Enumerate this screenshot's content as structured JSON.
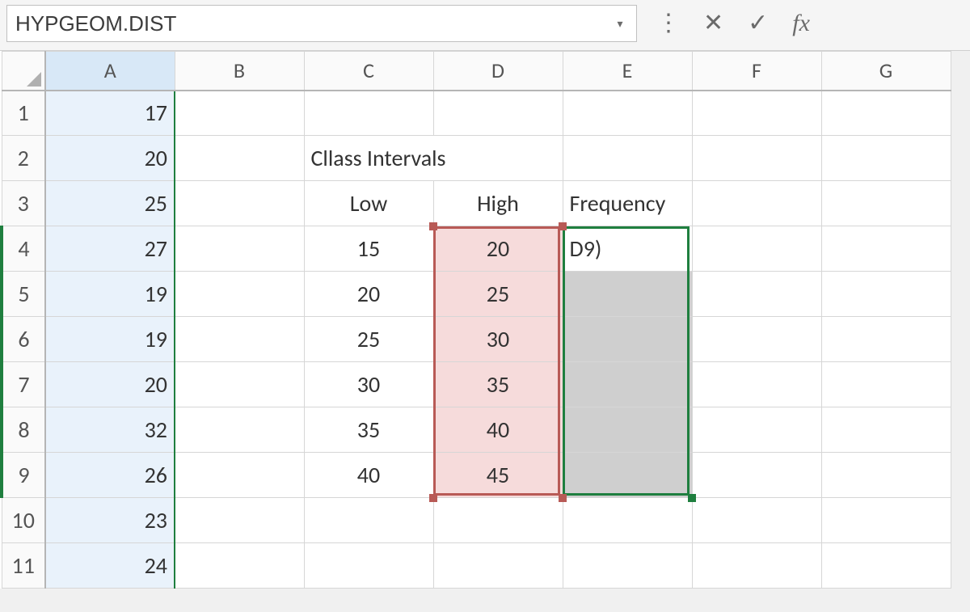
{
  "formula_bar": {
    "namebox_value": "HYPGEOM.DIST",
    "dropdown_glyph": "▾",
    "vdots_glyph": "⋮",
    "cancel_glyph": "✕",
    "enter_glyph": "✓",
    "fx_glyph": "fx"
  },
  "columns": [
    "A",
    "B",
    "C",
    "D",
    "E",
    "F",
    "G"
  ],
  "rows": [
    "1",
    "2",
    "3",
    "4",
    "5",
    "6",
    "7",
    "8",
    "9",
    "10",
    "11"
  ],
  "cells": {
    "A1": "17",
    "A2": "20",
    "A3": "25",
    "A4": "27",
    "A5": "19",
    "A6": "19",
    "A7": "20",
    "A8": "32",
    "A9": "26",
    "A10": "23",
    "A11": "24",
    "C2": "Cllass Intervals",
    "C3": "Low",
    "D3": "High",
    "E3": "Frequency",
    "C4": "15",
    "D4": "20",
    "E4": "D9)",
    "C5": "20",
    "D5": "25",
    "C6": "25",
    "D6": "30",
    "C7": "30",
    "D7": "35",
    "C8": "35",
    "D8": "40",
    "C9": "40",
    "D9": "45"
  },
  "chart_data": {
    "type": "table",
    "title": "Cllass Intervals",
    "columns": [
      "Low",
      "High",
      "Frequency"
    ],
    "rows": [
      {
        "Low": 15,
        "High": 20,
        "Frequency": "D9)"
      },
      {
        "Low": 20,
        "High": 25,
        "Frequency": ""
      },
      {
        "Low": 25,
        "High": 30,
        "Frequency": ""
      },
      {
        "Low": 30,
        "High": 35,
        "Frequency": ""
      },
      {
        "Low": 35,
        "High": 40,
        "Frequency": ""
      },
      {
        "Low": 40,
        "High": 45,
        "Frequency": ""
      }
    ],
    "data_column_A": [
      17,
      20,
      25,
      27,
      19,
      19,
      20,
      32,
      26,
      23,
      24
    ]
  }
}
